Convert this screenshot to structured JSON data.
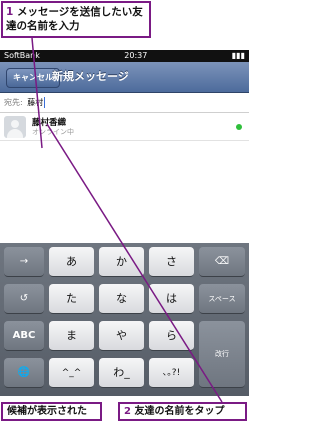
{
  "callouts": {
    "top": {
      "number": "1",
      "text": "メッセージを送信したい友達の名前を入力"
    },
    "bottom_left": {
      "text": "候補が表示された"
    },
    "bottom_right": {
      "number": "2",
      "text": "友達の名前をタップ"
    }
  },
  "status_bar": {
    "carrier": "SoftBank",
    "time": "20:37"
  },
  "nav": {
    "cancel_label": "キャンセル",
    "title": "新規メッセージ"
  },
  "to_field": {
    "label": "宛先:",
    "value": "藤村"
  },
  "suggestions": [
    {
      "name": "藤村香織",
      "status": "オンライン中",
      "online": true
    }
  ],
  "keyboard": {
    "rows": [
      [
        "→",
        "あ",
        "か",
        "さ",
        "⌫"
      ],
      [
        "↺",
        "た",
        "な",
        "は",
        "スペース"
      ],
      [
        "ABC",
        "ま",
        "や",
        "ら",
        "改行"
      ],
      [
        "🌐",
        "^_^",
        "わ_",
        "､｡?!"
      ]
    ]
  },
  "colors": {
    "accent": "#7a1a84",
    "nav_bar": "#5a76a6",
    "online": "#2fbf3b"
  }
}
